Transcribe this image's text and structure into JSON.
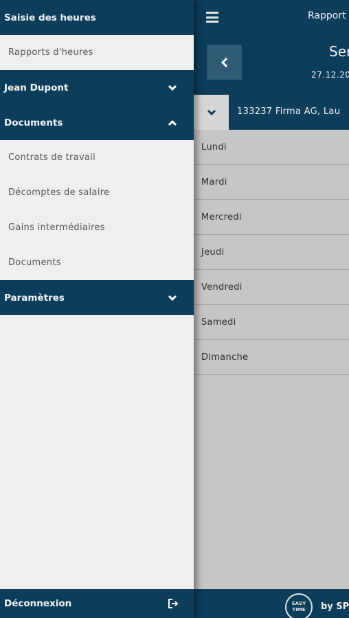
{
  "app": {
    "title": "Rapport",
    "week_title": "Ser",
    "week_date": "27.12.20",
    "project": "133237 Firma AG, Lau",
    "days": [
      "Lundi",
      "Mardi",
      "Mercredi",
      "Jeudi",
      "Vendredi",
      "Samedi",
      "Dimanche"
    ],
    "footer": {
      "logo_text_line1": "EASY",
      "logo_text_line2": "TIME",
      "by_label": "by SP"
    }
  },
  "drawer": {
    "time_entry_header": "Saisie des heures",
    "time_reports": "Rapports d'heures",
    "user_name": "Jean Dupont",
    "documents_header": "Documents",
    "document_items": [
      "Contrats de travail",
      "Décomptes de salaire",
      "Gains intermédiaires",
      "Documents"
    ],
    "settings": "Paramètres",
    "logout": "Déconnexion"
  },
  "colors": {
    "primary": "#0c3d5a",
    "drawer_bg": "#efefef",
    "overlay_bg": "#c6c6c6"
  },
  "icons": {
    "menu": "hamburger-icon",
    "back": "chevron-left-icon",
    "expand": "chevron-down-icon",
    "collapse": "chevron-up-icon",
    "logout": "logout-icon"
  }
}
